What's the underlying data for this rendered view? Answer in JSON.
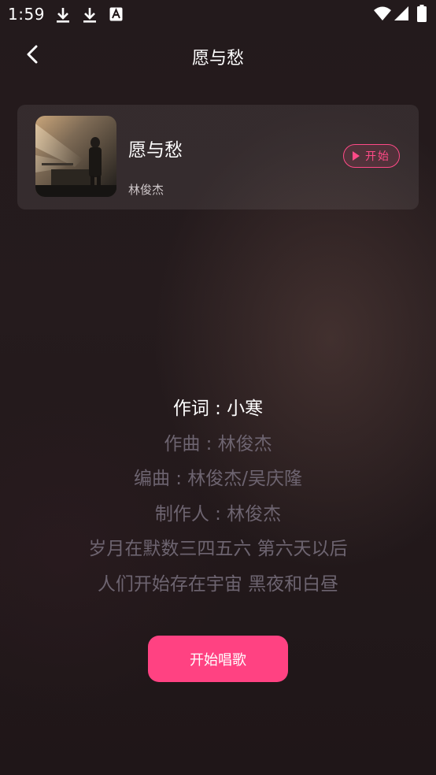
{
  "status_bar": {
    "time": "1:59",
    "icons": [
      "download-icon",
      "download-icon",
      "text-a-icon",
      "wifi-icon",
      "signal-icon",
      "battery-icon"
    ]
  },
  "header": {
    "title": "愿与愁",
    "back_icon": "chevron-left-icon"
  },
  "song_card": {
    "title": "愿与愁",
    "artist": "林俊杰",
    "start_label": "开始",
    "start_icon": "play-icon"
  },
  "lyrics": [
    "作词 : 小寒",
    "作曲 : 林俊杰",
    "编曲 : 林俊杰/吴庆隆",
    "制作人 : 林俊杰",
    "岁月在默数三四五六 第六天以后",
    "人们开始存在宇宙 黑夜和白昼"
  ],
  "sing_button": {
    "label": "开始唱歌"
  },
  "colors": {
    "accent": "#ff4282",
    "background": "#211719",
    "lyric_active": "#ffffff",
    "lyric_inactive": "#6d6470"
  }
}
